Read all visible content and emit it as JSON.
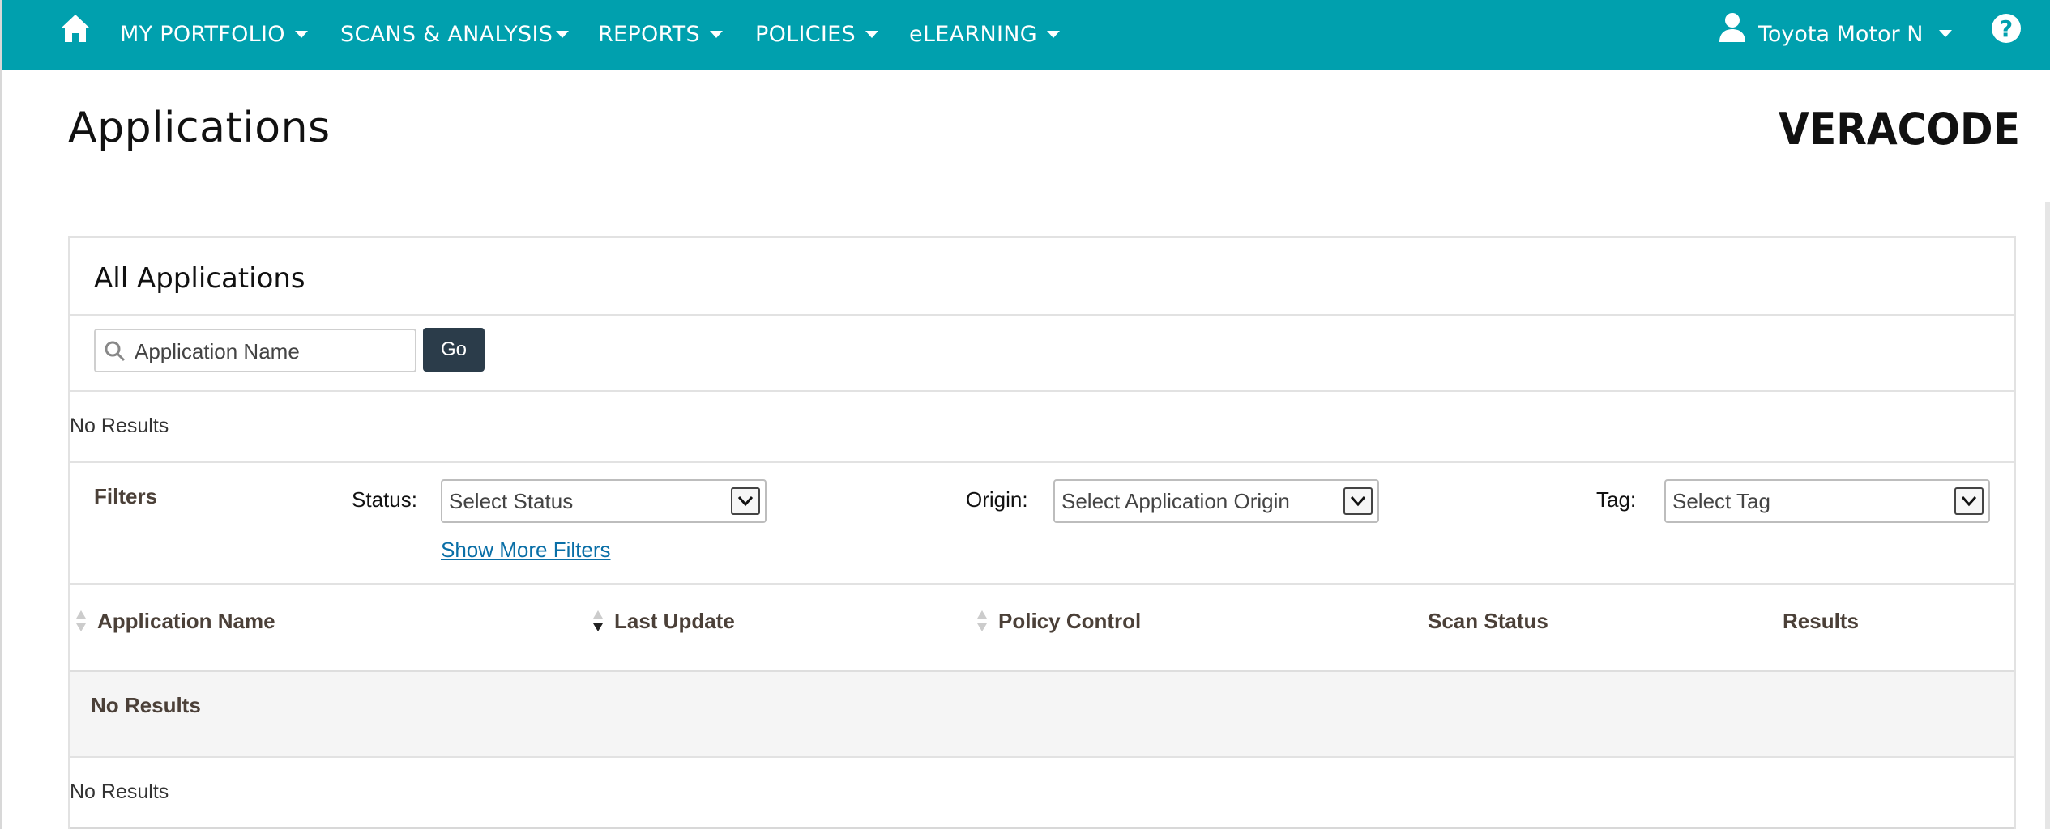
{
  "nav": {
    "items": [
      {
        "label": "MY PORTFOLIO"
      },
      {
        "label": "SCANS & ANALYSIS"
      },
      {
        "label": "REPORTS"
      },
      {
        "label": "POLICIES"
      },
      {
        "label": "eLEARNING"
      }
    ],
    "user_name": "Toyota Motor N",
    "help_glyph": "?"
  },
  "page": {
    "title": "Applications",
    "logo_text": "VERACODE"
  },
  "panel": {
    "title": "All Applications",
    "search": {
      "placeholder": "Application Name",
      "value": "",
      "go_label": "Go"
    },
    "no_results_top": "No Results",
    "filters": {
      "label": "Filters",
      "status_label": "Status:",
      "status_value": "Select Status",
      "origin_label": "Origin:",
      "origin_value": "Select Application Origin",
      "tag_label": "Tag:",
      "tag_value": "Select Tag",
      "show_more": "Show More Filters"
    },
    "columns": [
      {
        "label": "Application Name",
        "sort": "none"
      },
      {
        "label": "Last Update",
        "sort": "desc"
      },
      {
        "label": "Policy Control",
        "sort": "none"
      },
      {
        "label": "Scan Status"
      },
      {
        "label": "Results"
      }
    ],
    "group_row": "No Results",
    "no_results_bottom": "No Results"
  },
  "colors": {
    "nav_bg": "#00a0ae",
    "go_button": "#2b3c4a",
    "link": "#0a6fa7",
    "header_text": "#4b4038"
  }
}
